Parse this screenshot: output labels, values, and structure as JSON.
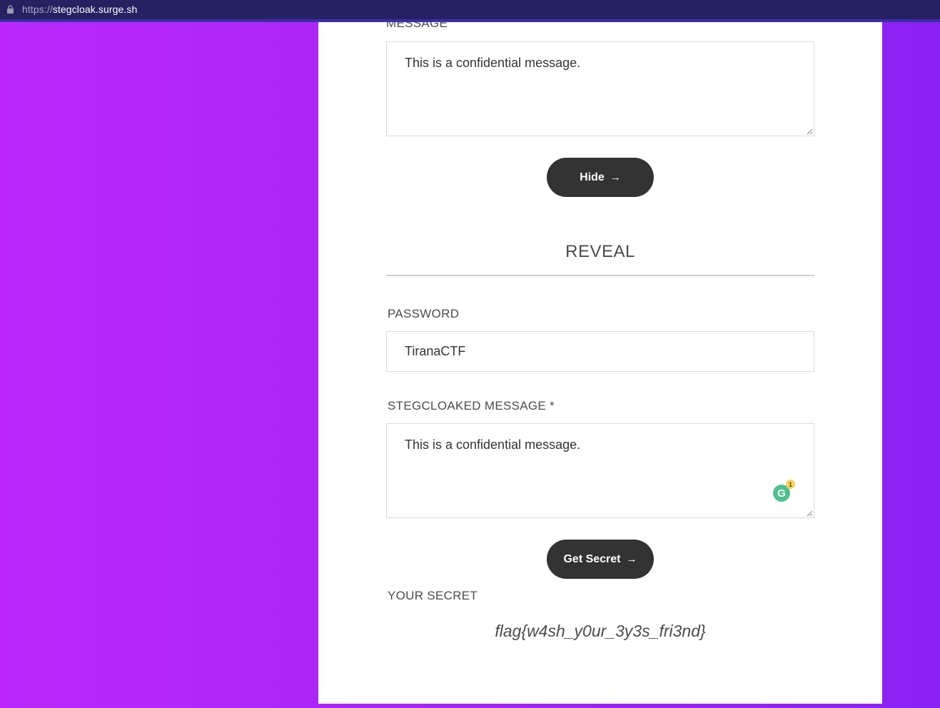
{
  "browser": {
    "url_scheme": "https://",
    "url_host": "stegcloak.surge.sh"
  },
  "hide_section": {
    "message_label": "MESSAGE",
    "message_value": "This is a confidential message.",
    "hide_button_label": "Hide",
    "arrow_glyph": "→"
  },
  "reveal_section": {
    "title": "REVEAL",
    "password_label": "PASSWORD",
    "password_value": "TiranaCTF",
    "stego_label": "STEGCLOAKED MESSAGE *",
    "stego_value": "This is a confidential message.",
    "grammarly_letter": "G",
    "grammarly_count": "1",
    "get_secret_label": "Get Secret",
    "arrow_glyph": "→",
    "secret_label": "YOUR SECRET",
    "secret_value": "flag{w4sh_y0ur_3y3s_fri3nd}"
  },
  "colors": {
    "background_start": "#bc28fb",
    "background_end": "#8a22f3",
    "button": "#333333",
    "addressbar": "#262261"
  }
}
